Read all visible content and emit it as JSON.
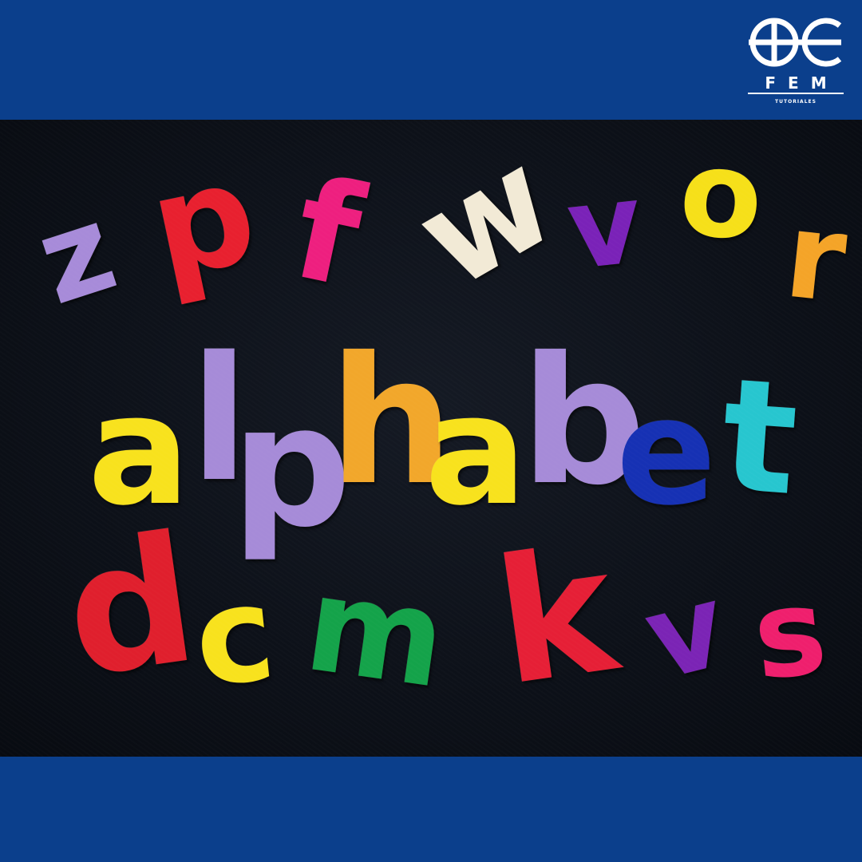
{
  "logo": {
    "brand": "FEM",
    "tagline": "TUTORIALES",
    "icon": "fem-logo-icon",
    "color": "#ffffff"
  },
  "colors": {
    "band": "#0b3f8c",
    "board": "#0d1119"
  },
  "rows": {
    "top": [
      {
        "char": "z",
        "color": "#a78bd9"
      },
      {
        "char": "p",
        "color": "#e8202f"
      },
      {
        "char": "f",
        "color": "#ee1f7f"
      },
      {
        "char": "w",
        "color": "#f2ead6"
      },
      {
        "char": "v",
        "color": "#7a22b8"
      },
      {
        "char": "o",
        "color": "#f6e019"
      },
      {
        "char": "r",
        "color": "#f4a428"
      }
    ],
    "middle": [
      {
        "char": "a",
        "color": "#f8e21d"
      },
      {
        "char": "l",
        "color": "#a68bd8"
      },
      {
        "char": "p",
        "color": "#a68bd8"
      },
      {
        "char": "h",
        "color": "#f2a72b"
      },
      {
        "char": "a",
        "color": "#f8e21d"
      },
      {
        "char": "b",
        "color": "#a68bd8"
      },
      {
        "char": "e",
        "color": "#1631b4"
      },
      {
        "char": "t",
        "color": "#27c6cf"
      }
    ],
    "bottom": [
      {
        "char": "d",
        "color": "#e01f2d"
      },
      {
        "char": "c",
        "color": "#f8e21d"
      },
      {
        "char": "m",
        "color": "#14a34a"
      },
      {
        "char": "k",
        "color": "#e61f36"
      },
      {
        "char": "v",
        "color": "#7b24b5"
      },
      {
        "char": "s",
        "color": "#ef1f6d"
      }
    ]
  }
}
